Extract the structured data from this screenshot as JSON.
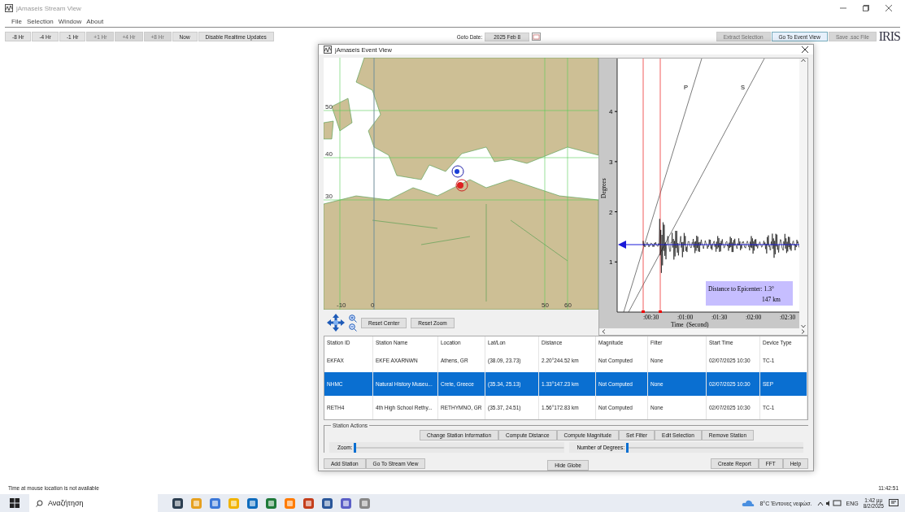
{
  "window": {
    "title": "jAmaseis Stream View"
  },
  "menu": [
    "File",
    "Selection",
    "Window",
    "About"
  ],
  "toolbar": {
    "time_buttons": [
      {
        "label": "-8 Hr",
        "disabled": false
      },
      {
        "label": "-4 Hr",
        "disabled": false
      },
      {
        "label": "-1 Hr",
        "disabled": false
      },
      {
        "label": "+1 Hr",
        "disabled": true
      },
      {
        "label": "+4 Hr",
        "disabled": true
      },
      {
        "label": "+8 Hr",
        "disabled": true
      },
      {
        "label": "Now",
        "disabled": false
      },
      {
        "label": "Disable Realtime Updates",
        "disabled": false
      }
    ],
    "goto_label": "Goto Date:",
    "goto_value": "2025 Feb 8",
    "actions": [
      {
        "label": "Extract Selection",
        "disabled": true,
        "selected": false
      },
      {
        "label": "Go To Event View",
        "disabled": false,
        "selected": true
      },
      {
        "label": "Save .sac File",
        "disabled": true,
        "selected": false
      }
    ]
  },
  "logo": "IRIS",
  "event_view": {
    "title": "jAmaseis Event View",
    "map": {
      "lat_labels": [
        "50",
        "40",
        "30"
      ],
      "lon_labels": [
        "-10",
        "0",
        "50",
        "60"
      ]
    },
    "map_buttons": [
      "Reset Center",
      "Reset Zoom"
    ],
    "plot": {
      "ylabel": "Degrees",
      "y_ticks": [
        "4",
        "3",
        "2",
        "1"
      ],
      "xlabel": "Time  (Second)",
      "x_ticks": [
        ":00:30",
        ":01:00",
        ":01:30",
        ":02:00",
        ":02:30"
      ],
      "phases": [
        "P",
        "S"
      ],
      "info": [
        "Distance to Epicenter: 1.3°",
        "147 km"
      ]
    },
    "table": {
      "columns": [
        "Station ID",
        "Station Name",
        "Location",
        "Lat/Lon",
        "Distance",
        "Magnitude",
        "Filter",
        "Start Time",
        "Device Type"
      ],
      "rows": [
        {
          "selected": false,
          "cells": [
            "EKFAX",
            "EKFE AXARNWN",
            "Athens, GR",
            "(38.09, 23.73)",
            "2.20°244.52 km",
            "Not Computed",
            "None",
            "02/07/2025 10:30",
            "TC-1"
          ]
        },
        {
          "selected": true,
          "cells": [
            "NHMC",
            "Natural History Museu...",
            "Crete, Greece",
            "(35.34, 25.13)",
            "1.33°147.23 km",
            "Not Computed",
            "None",
            "02/07/2025 10:30",
            "SEP"
          ]
        },
        {
          "selected": false,
          "cells": [
            "RETH4",
            "4th High School Rethy...",
            "RETHYMNO, GR",
            "(35.37, 24.51)",
            "1.56°172.83 km",
            "Not Computed",
            "None",
            "02/07/2025 10:30",
            "TC-1"
          ]
        }
      ]
    },
    "station_actions": {
      "title": "Station Actions",
      "buttons": [
        "Change Station Information",
        "Compute Distance",
        "Compute Magnitude",
        "Set Filter",
        "Edit Selection",
        "Remove Station"
      ]
    },
    "sliders": [
      {
        "label": "Zoom:",
        "level": 0.0
      },
      {
        "label": "Number of Degrees:",
        "level": 0.0
      }
    ],
    "bottom_left": [
      "Add Station",
      "Go To Stream View"
    ],
    "bottom_center": [
      "Hide Globe"
    ],
    "bottom_right": [
      "Create Report",
      "FFT",
      "Help"
    ]
  },
  "status": "Time at mouse location is not available",
  "clock": "11:42:51",
  "taskbar": {
    "search_placeholder": "Αναζήτηση",
    "weather": "8°C  Έντονες νεφώσ.",
    "lang": "ENG",
    "time": "1:42 μμ",
    "date": "8/2/2025"
  }
}
